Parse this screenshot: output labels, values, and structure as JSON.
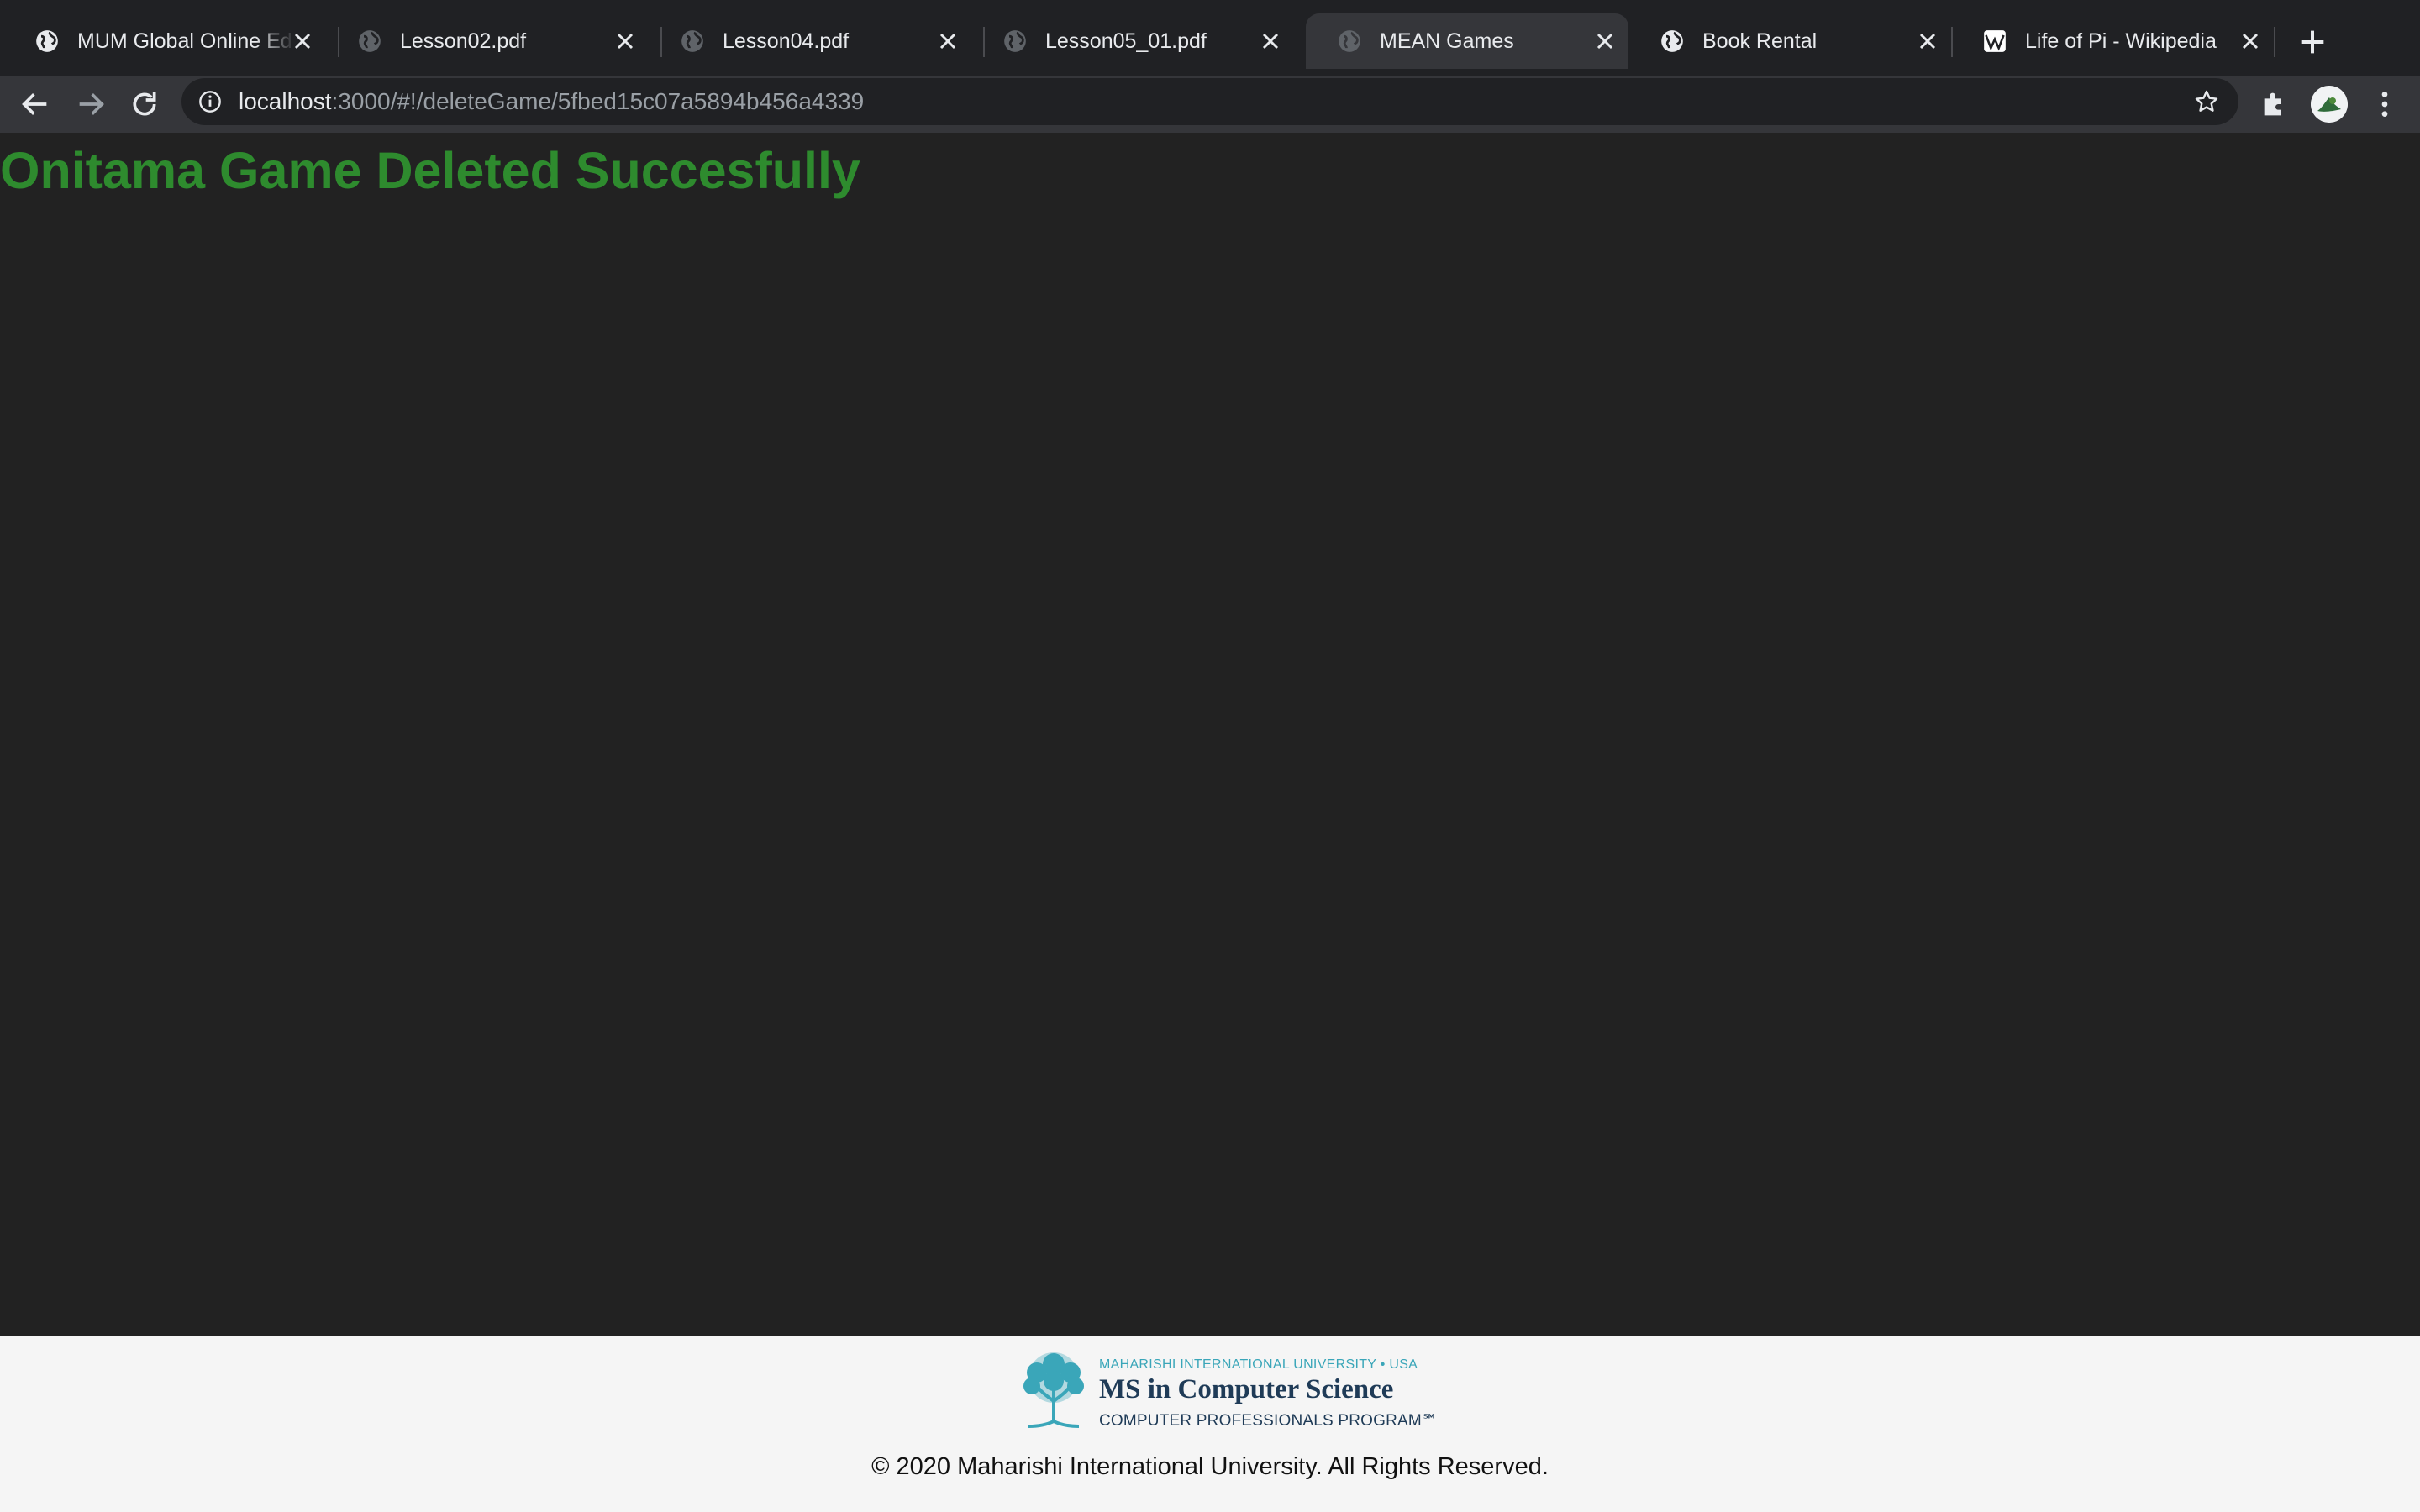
{
  "browser": {
    "tabs": [
      {
        "title": "MUM Global Online Ed",
        "favicon": "globe-icon",
        "active": false
      },
      {
        "title": "Lesson02.pdf",
        "favicon": "globe-icon",
        "active": false
      },
      {
        "title": "Lesson04.pdf",
        "favicon": "globe-icon",
        "active": false
      },
      {
        "title": "Lesson05_01.pdf",
        "favicon": "globe-icon",
        "active": false
      },
      {
        "title": "MEAN Games",
        "favicon": "globe-icon",
        "active": true
      },
      {
        "title": "Book Rental",
        "favicon": "globe-icon",
        "active": false
      },
      {
        "title": "Life of Pi - Wikipedia",
        "favicon": "wikipedia-icon",
        "active": false
      }
    ],
    "address": {
      "host": "localhost",
      "rest": ":3000/#!/deleteGame/5fbed15c07a5894b456a4339"
    }
  },
  "page": {
    "heading": "Onitama Game Deleted Succesfully",
    "heading_color": "#2e8b2e",
    "background": "#222222"
  },
  "footer": {
    "logo": {
      "line1": "MAHARISHI INTERNATIONAL UNIVERSITY • USA",
      "line2": "MS in Computer Science",
      "line3": "COMPUTER PROFESSIONALS PROGRAM℠"
    },
    "copyright": "© 2020 Maharishi International University. All Rights Reserved."
  },
  "colors": {
    "tabstrip": "#202124",
    "toolbar": "#35363a",
    "footer_bg": "#f5f5f5",
    "logo_accent": "#3aa6b9",
    "logo_primary": "#1f3b57"
  }
}
